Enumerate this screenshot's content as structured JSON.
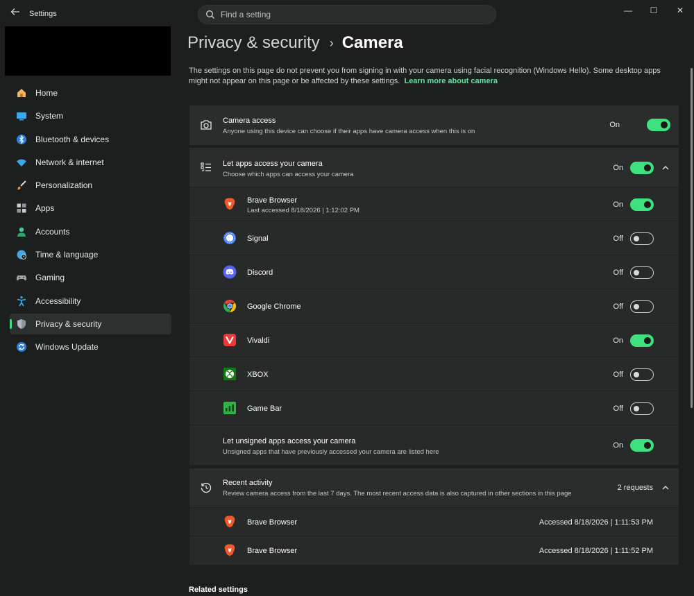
{
  "app": {
    "title": "Settings"
  },
  "search": {
    "placeholder": "Find a setting"
  },
  "window_controls": {
    "minimize": "—",
    "maximize": "☐",
    "close": "✕"
  },
  "sidebar": {
    "items": [
      {
        "label": "Home",
        "icon": "home-icon"
      },
      {
        "label": "System",
        "icon": "system-icon"
      },
      {
        "label": "Bluetooth & devices",
        "icon": "bluetooth-icon"
      },
      {
        "label": "Network & internet",
        "icon": "network-icon"
      },
      {
        "label": "Personalization",
        "icon": "brush-icon"
      },
      {
        "label": "Apps",
        "icon": "apps-icon"
      },
      {
        "label": "Accounts",
        "icon": "accounts-icon"
      },
      {
        "label": "Time & language",
        "icon": "globe-icon"
      },
      {
        "label": "Gaming",
        "icon": "gamepad-icon"
      },
      {
        "label": "Accessibility",
        "icon": "accessibility-icon"
      },
      {
        "label": "Privacy & security",
        "icon": "shield-icon",
        "active": true
      },
      {
        "label": "Windows Update",
        "icon": "update-icon"
      }
    ]
  },
  "breadcrumb": {
    "parent": "Privacy & security",
    "separator": "›",
    "current": "Camera"
  },
  "intro": {
    "text": "The settings on this page do not prevent you from signing in with your camera using facial recognition (Windows Hello). Some desktop apps might not appear on this page or be affected by these settings.",
    "link": "Learn more about camera"
  },
  "camera_access": {
    "title": "Camera access",
    "description": "Anyone using this device can choose if their apps have camera access when this is on",
    "state": "On"
  },
  "let_apps": {
    "title": "Let apps access your camera",
    "description": "Choose which apps can access your camera",
    "state": "On",
    "apps": [
      {
        "name": "Brave Browser",
        "detail": "Last accessed 8/18/2026  |  1:12:02 PM",
        "state": "On",
        "icon": "brave-icon"
      },
      {
        "name": "Signal",
        "state": "Off",
        "icon": "signal-icon"
      },
      {
        "name": "Discord",
        "state": "Off",
        "icon": "discord-icon"
      },
      {
        "name": "Google Chrome",
        "state": "Off",
        "icon": "chrome-icon"
      },
      {
        "name": "Vivaldi",
        "state": "On",
        "icon": "vivaldi-icon"
      },
      {
        "name": "XBOX",
        "state": "Off",
        "icon": "xbox-icon"
      },
      {
        "name": "Game Bar",
        "state": "Off",
        "icon": "game-bar-icon"
      }
    ],
    "unsigned": {
      "title": "Let unsigned apps access your camera",
      "description": "Unsigned apps that have previously accessed your camera are listed here",
      "state": "On"
    }
  },
  "recent_activity": {
    "title": "Recent activity",
    "description": "Review camera access from the last 7 days. The most recent access data is also captured in other sections in this page",
    "count": "2 requests",
    "entries": [
      {
        "name": "Brave Browser",
        "accessed": "Accessed 8/18/2026  |  1:11:53 PM"
      },
      {
        "name": "Brave Browser",
        "accessed": "Accessed 8/18/2026  |  1:11:52 PM"
      }
    ]
  },
  "related_settings": {
    "title": "Related settings"
  },
  "colors": {
    "accent": "#3ee07f",
    "background": "#1c1f1e",
    "card": "#2a2d2c",
    "link": "#5fe39a"
  }
}
